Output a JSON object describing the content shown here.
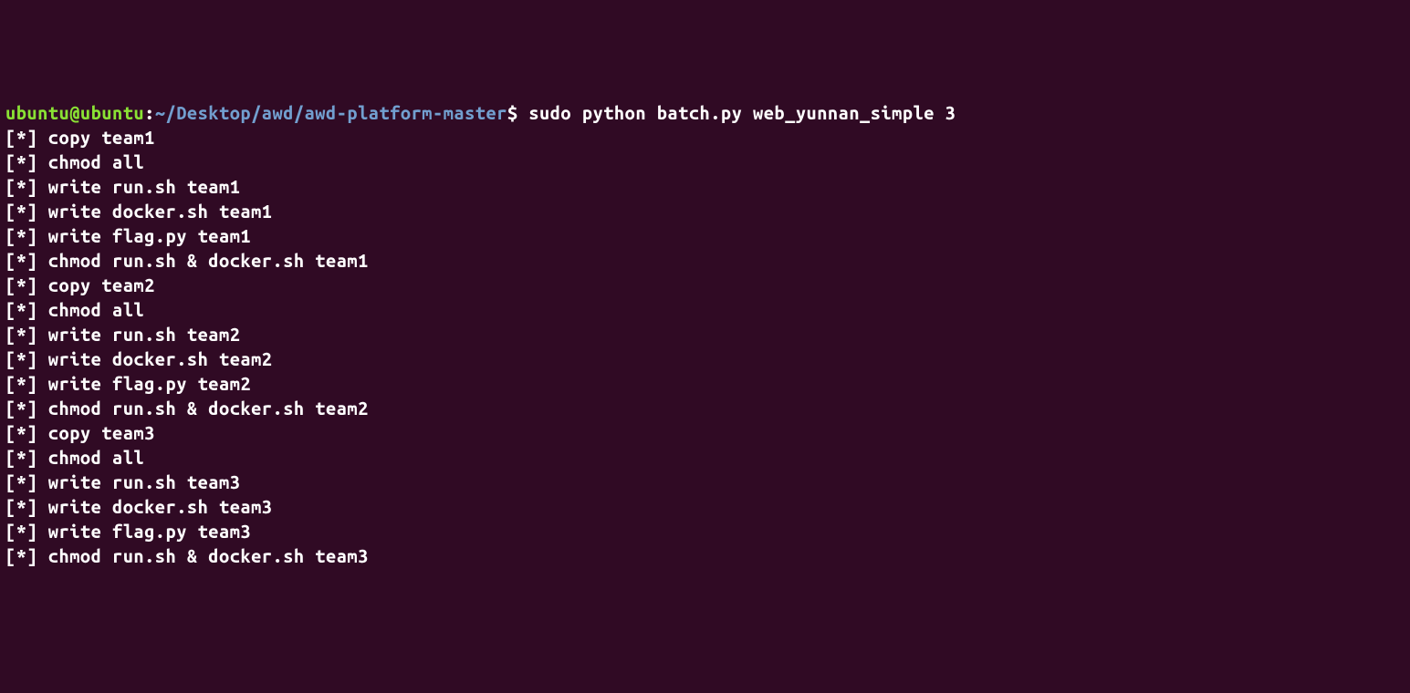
{
  "prompt": {
    "user_host": "ubuntu@ubuntu",
    "colon": ":",
    "path": "~/Desktop/awd/awd-platform-master",
    "dollar": "$"
  },
  "command": "sudo python batch.py web_yunnan_simple 3",
  "lines": [
    "[*] copy team1",
    "[*] chmod all",
    "[*] write run.sh team1",
    "[*] write docker.sh team1",
    "[*] write flag.py team1",
    "[*] chmod run.sh & docker.sh team1",
    "[*] copy team2",
    "[*] chmod all",
    "[*] write run.sh team2",
    "[*] write docker.sh team2",
    "[*] write flag.py team2",
    "[*] chmod run.sh & docker.sh team2",
    "[*] copy team3",
    "[*] chmod all",
    "[*] write run.sh team3",
    "[*] write docker.sh team3",
    "[*] write flag.py team3",
    "[*] chmod run.sh & docker.sh team3"
  ]
}
